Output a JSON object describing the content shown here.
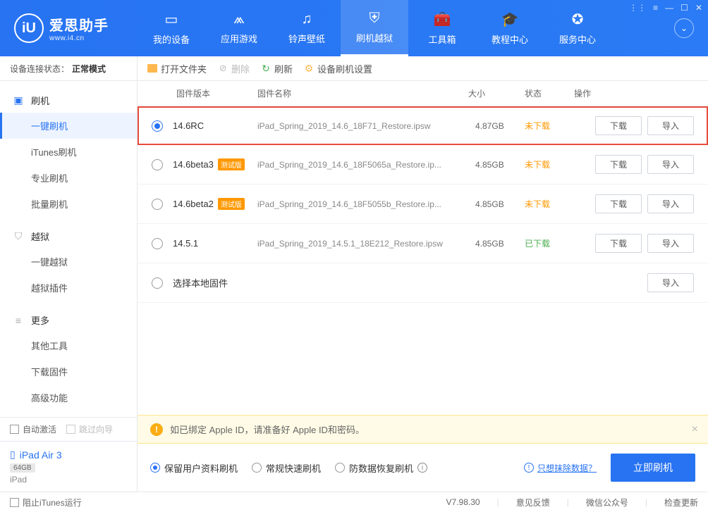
{
  "app": {
    "name": "爱思助手",
    "url": "www.i4.cn"
  },
  "nav": [
    {
      "label": "我的设备"
    },
    {
      "label": "应用游戏"
    },
    {
      "label": "铃声壁纸"
    },
    {
      "label": "刷机越狱"
    },
    {
      "label": "工具箱"
    },
    {
      "label": "教程中心"
    },
    {
      "label": "服务中心"
    }
  ],
  "sidebar": {
    "status_label": "设备连接状态：",
    "status_mode": "正常模式",
    "sections": {
      "flash": {
        "title": "刷机",
        "items": [
          "一键刷机",
          "iTunes刷机",
          "专业刷机",
          "批量刷机"
        ]
      },
      "jailbreak": {
        "title": "越狱",
        "items": [
          "一键越狱",
          "越狱插件"
        ]
      },
      "more": {
        "title": "更多",
        "items": [
          "其他工具",
          "下载固件",
          "高级功能"
        ]
      }
    },
    "auto_activate": "自动激活",
    "skip_wizard": "跳过向导",
    "device": {
      "name": "iPad Air 3",
      "storage": "64GB",
      "type": "iPad"
    }
  },
  "toolbar": {
    "open_folder": "打开文件夹",
    "delete": "删除",
    "refresh": "刷新",
    "settings": "设备刷机设置"
  },
  "table": {
    "headers": {
      "version": "固件版本",
      "name": "固件名称",
      "size": "大小",
      "status": "状态",
      "action": "操作"
    },
    "rows": [
      {
        "version": "14.6RC",
        "beta": false,
        "name": "iPad_Spring_2019_14.6_18F71_Restore.ipsw",
        "size": "4.87GB",
        "status": "未下载",
        "status_class": "nd"
      },
      {
        "version": "14.6beta3",
        "beta": true,
        "name": "iPad_Spring_2019_14.6_18F5065a_Restore.ip...",
        "size": "4.85GB",
        "status": "未下载",
        "status_class": "nd"
      },
      {
        "version": "14.6beta2",
        "beta": true,
        "name": "iPad_Spring_2019_14.6_18F5055b_Restore.ip...",
        "size": "4.85GB",
        "status": "未下载",
        "status_class": "nd"
      },
      {
        "version": "14.5.1",
        "beta": false,
        "name": "iPad_Spring_2019_14.5.1_18E212_Restore.ipsw",
        "size": "4.85GB",
        "status": "已下载",
        "status_class": "dl"
      }
    ],
    "local_firmware": "选择本地固件",
    "beta_tag": "测试版",
    "btn_download": "下载",
    "btn_import": "导入"
  },
  "alert": "如已绑定 Apple ID，请准备好 Apple ID和密码。",
  "options": {
    "keep_data": "保留用户资料刷机",
    "normal": "常规快速刷机",
    "anti_recovery": "防数据恢复刷机",
    "erase_link": "只想抹除数据？",
    "flash_btn": "立即刷机"
  },
  "footer": {
    "block_itunes": "阻止iTunes运行",
    "version": "V7.98.30",
    "feedback": "意见反馈",
    "wechat": "微信公众号",
    "update": "检查更新"
  }
}
